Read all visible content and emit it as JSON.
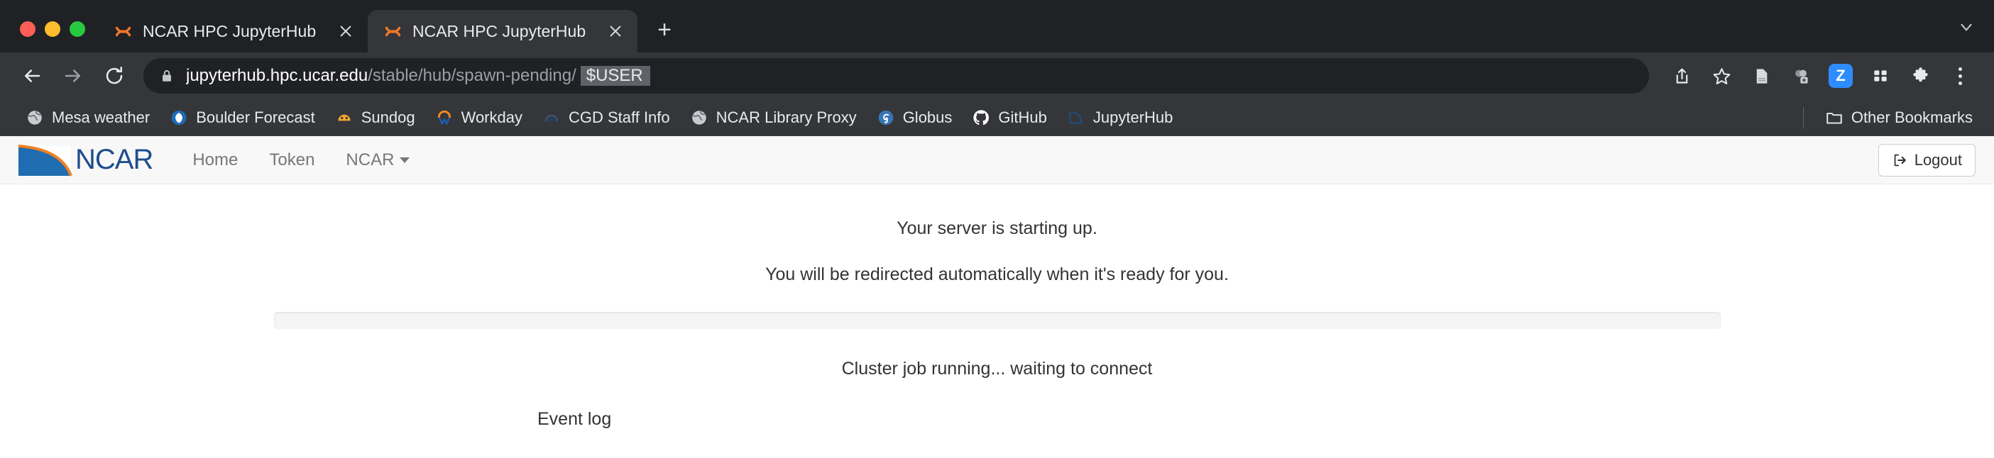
{
  "browser": {
    "tabs": [
      {
        "title": "NCAR HPC JupyterHub",
        "active": false,
        "favicon": "jupyter-icon"
      },
      {
        "title": "NCAR HPC JupyterHub",
        "active": true,
        "favicon": "jupyter-icon"
      }
    ],
    "new_tab_label": "+",
    "tab_list_chevron": "⌄",
    "nav": {
      "back": "←",
      "forward": "→",
      "reload": "⟳"
    },
    "omnibox": {
      "lock_icon": "lock-icon",
      "host": "jupyterhub.hpc.ucar.edu",
      "path": "/stable/hub/spawn-pending/",
      "redacted_user": "$USER"
    },
    "toolbar_icons": [
      "share-icon",
      "bookmark-star-icon",
      "reading-list-icon",
      "screen-capture-icon",
      "zoom-extension-icon",
      "apps-grid-icon",
      "extensions-puzzle-icon",
      "more-menu-icon"
    ],
    "zoom_badge_label": "Z",
    "bookmarks": [
      {
        "label": "Mesa weather",
        "icon": "globe-icon"
      },
      {
        "label": "Boulder Forecast",
        "icon": "noaa-icon"
      },
      {
        "label": "Sundog",
        "icon": "sundog-icon"
      },
      {
        "label": "Workday",
        "icon": "workday-icon"
      },
      {
        "label": "CGD Staff Info",
        "icon": "cgd-icon"
      },
      {
        "label": "NCAR Library Proxy",
        "icon": "globe-icon"
      },
      {
        "label": "Globus",
        "icon": "globus-icon"
      },
      {
        "label": "GitHub",
        "icon": "github-icon"
      },
      {
        "label": "JupyterHub",
        "icon": "ncar-icon"
      }
    ],
    "other_bookmarks": {
      "label": "Other Bookmarks",
      "icon": "folder-icon"
    }
  },
  "jupyterhub": {
    "brand": "NCAR",
    "nav_links": [
      {
        "label": "Home"
      },
      {
        "label": "Token"
      },
      {
        "label": "NCAR",
        "has_caret": true
      }
    ],
    "logout": {
      "label": "Logout",
      "icon": "sign-out-icon"
    }
  },
  "main": {
    "heading": "Your server is starting up.",
    "subheading": "You will be redirected automatically when it's ready for you.",
    "progress_percent": 0,
    "status": "Cluster job running... waiting to connect",
    "event_log_label": "Event log"
  },
  "colors": {
    "chrome_bg": "#202124",
    "toolbar_bg": "#35363a",
    "accent_orange": "#f37726",
    "zoom_blue": "#2d8cff",
    "ncar_blue": "#1f6cb0"
  }
}
